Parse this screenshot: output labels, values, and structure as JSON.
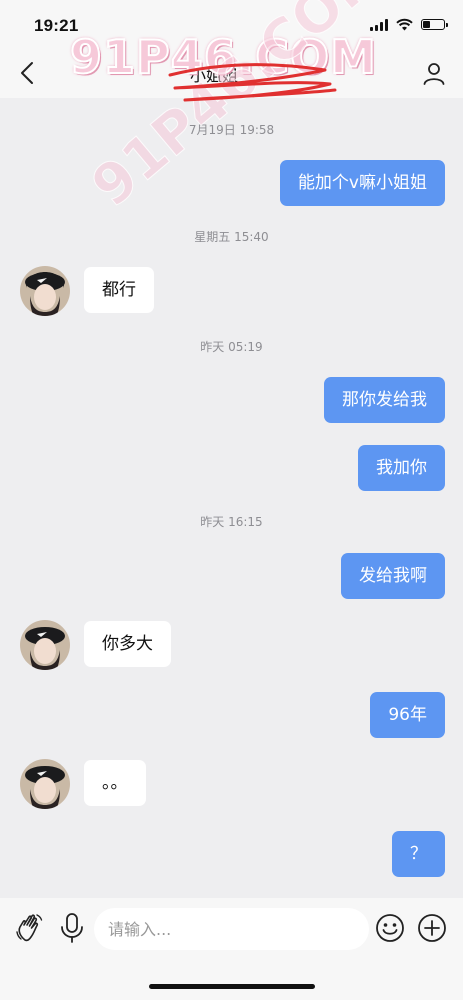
{
  "status_bar": {
    "time": "19:21"
  },
  "nav": {
    "title": "小姐姐"
  },
  "watermark": {
    "text": "91P46.COM"
  },
  "messages": [
    {
      "kind": "time",
      "text": "7月19日 19:58"
    },
    {
      "kind": "out",
      "text": "能加个v嘛小姐姐"
    },
    {
      "kind": "time",
      "text": "星期五 15:40"
    },
    {
      "kind": "in",
      "text": "都行"
    },
    {
      "kind": "time",
      "text": "昨天 05:19"
    },
    {
      "kind": "out",
      "text": "那你发给我"
    },
    {
      "kind": "out",
      "text": "我加你"
    },
    {
      "kind": "time",
      "text": "昨天 16:15"
    },
    {
      "kind": "out",
      "text": "发给我啊"
    },
    {
      "kind": "in",
      "text": "你多大"
    },
    {
      "kind": "out",
      "text": "96年"
    },
    {
      "kind": "in",
      "text": "。。"
    },
    {
      "kind": "out",
      "text": "？"
    }
  ],
  "input": {
    "placeholder": "请输入..."
  },
  "colors": {
    "outgoing_bubble": "#5d96f2",
    "incoming_bubble": "#ffffff",
    "background": "#eeeef0"
  }
}
